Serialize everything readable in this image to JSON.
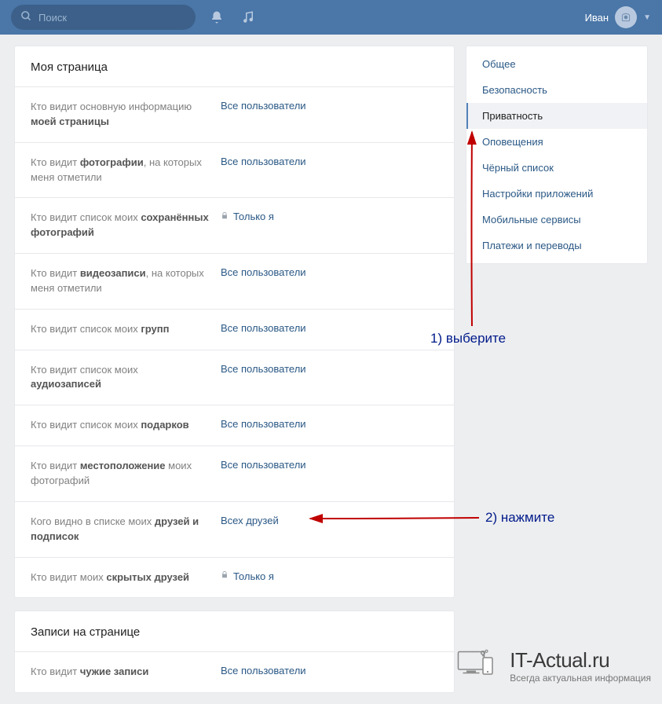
{
  "topbar": {
    "search_placeholder": "Поиск",
    "user_name": "Иван"
  },
  "section1_title": "Моя страница",
  "settings": [
    {
      "label_html": "Кто видит основную информацию <b>моей страницы</b>",
      "value": "Все пользователи",
      "locked": false
    },
    {
      "label_html": "Кто видит <b>фотографии</b>, на которых меня отметили",
      "value": "Все пользователи",
      "locked": false
    },
    {
      "label_html": "Кто видит список моих <b>сохранённых фотографий</b>",
      "value": "Только я",
      "locked": true
    },
    {
      "label_html": "Кто видит <b>видеозаписи</b>, на которых меня отметили",
      "value": "Все пользователи",
      "locked": false
    },
    {
      "label_html": "Кто видит список моих <b>групп</b>",
      "value": "Все пользователи",
      "locked": false
    },
    {
      "label_html": "Кто видит список моих <b>аудиозаписей</b>",
      "value": "Все пользователи",
      "locked": false
    },
    {
      "label_html": "Кто видит список моих <b>подарков</b>",
      "value": "Все пользователи",
      "locked": false
    },
    {
      "label_html": "Кто видит <b>местоположение</b> моих фотографий",
      "value": "Все пользователи",
      "locked": false
    },
    {
      "label_html": "Кого видно в списке моих <b>друзей и подписок</b>",
      "value": "Всех друзей",
      "locked": false
    },
    {
      "label_html": "Кто видит моих <b>скрытых друзей</b>",
      "value": "Только я",
      "locked": true
    }
  ],
  "section2_title": "Записи на странице",
  "settings2": [
    {
      "label_html": "Кто видит <b>чужие записи</b>",
      "value": "Все пользователи",
      "locked": false
    }
  ],
  "sidebar": {
    "items": [
      "Общее",
      "Безопасность",
      "Приватность",
      "Оповещения",
      "Чёрный список",
      "Настройки приложений",
      "Мобильные сервисы",
      "Платежи и переводы"
    ],
    "active_index": 2
  },
  "annotations": {
    "step1": "1) выберите",
    "step2": "2) нажмите"
  },
  "watermark": {
    "title": "IT-Actual.ru",
    "subtitle": "Всегда актуальная информация"
  }
}
